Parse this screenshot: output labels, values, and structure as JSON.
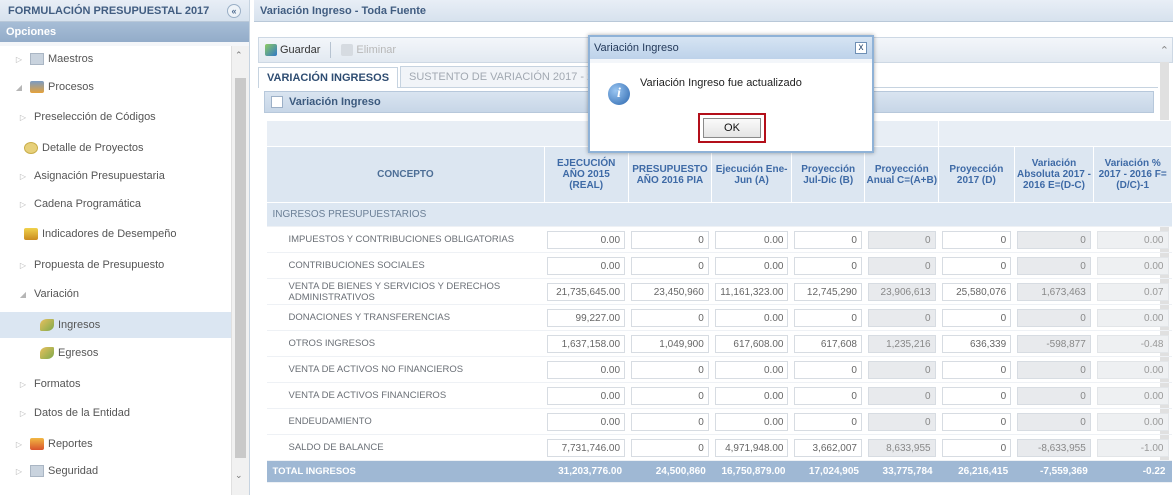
{
  "left_panel": {
    "title": "FORMULACIÓN PRESUPUESTAL 2017",
    "collapse_glyph": "«",
    "options_label": "Opciones",
    "tree": [
      {
        "label": "Maestros",
        "indent": 0,
        "arrow": "▷",
        "icon": "folder-icon"
      },
      {
        "label": "Procesos",
        "indent": 0,
        "arrow": "◢",
        "icon": "process-icon"
      },
      {
        "label": "Preselección de Códigos",
        "indent": 1,
        "arrow": "▷",
        "icon": ""
      },
      {
        "label": "Detalle de Proyectos",
        "indent": 2,
        "arrow": "",
        "icon": "detail-icon"
      },
      {
        "label": "Asignación Presupuestaria",
        "indent": 1,
        "arrow": "▷",
        "icon": ""
      },
      {
        "label": "Cadena Programática",
        "indent": 1,
        "arrow": "▷",
        "icon": ""
      },
      {
        "label": "Indicadores de Desempeño",
        "indent": 2,
        "arrow": "",
        "icon": "indicator-icon"
      },
      {
        "label": "Propuesta de Presupuesto",
        "indent": 1,
        "arrow": "▷",
        "icon": ""
      },
      {
        "label": "Variación",
        "indent": 1,
        "arrow": "◢",
        "icon": ""
      },
      {
        "label": "Ingresos",
        "indent": 3,
        "arrow": "",
        "icon": "leaf-icon",
        "selected": true
      },
      {
        "label": "Egresos",
        "indent": 3,
        "arrow": "",
        "icon": "leaf-icon"
      },
      {
        "label": "Formatos",
        "indent": 1,
        "arrow": "▷",
        "icon": ""
      },
      {
        "label": "Datos de la Entidad",
        "indent": 1,
        "arrow": "▷",
        "icon": ""
      },
      {
        "label": "Reportes",
        "indent": 0,
        "arrow": "▷",
        "icon": "report-icon"
      },
      {
        "label": "Seguridad",
        "indent": 0,
        "arrow": "▷",
        "icon": "security-icon"
      }
    ]
  },
  "main": {
    "title": "Variación Ingreso - Toda Fuente",
    "toolbar": {
      "save_label": "Guardar",
      "delete_label": "Eliminar"
    },
    "tabs": [
      {
        "label": "VARIACIÓN INGRESOS",
        "active": true
      },
      {
        "label": "SUSTENTO DE VARIACIÓN 2017 - 2016",
        "active": false
      }
    ],
    "section_title": "Variación Ingreso",
    "columns": [
      {
        "key": "concepto",
        "label": "CONCEPTO"
      },
      {
        "key": "ejec2015",
        "label": "EJECUCIÓN AÑO 2015 (REAL)"
      },
      {
        "key": "pia2016",
        "label": "PRESUPUESTO AÑO 2016 PIA"
      },
      {
        "key": "ejecA",
        "label": "Ejecución Ene-Jun (A)"
      },
      {
        "key": "proyB",
        "label": "Proyección Jul-Dic (B)"
      },
      {
        "key": "proyC",
        "label": "Proyección Anual C=(A+B)"
      },
      {
        "key": "proyD",
        "label": "Proyección 2017 (D)"
      },
      {
        "key": "varE",
        "label": "Variación Absoluta 2017 - 2016 E=(D-C)"
      },
      {
        "key": "varF",
        "label": "Variación % 2017 - 2016 F=(D/C)-1"
      }
    ],
    "group_label": "INGRESOS PRESUPUESTARIOS",
    "rows": [
      {
        "concepto": "IMPUESTOS Y CONTRIBUCIONES OBLIGATORIAS",
        "values": [
          "0.00",
          "0",
          "0.00",
          "0",
          "0",
          "0",
          "0",
          "0.00"
        ]
      },
      {
        "concepto": "CONTRIBUCIONES SOCIALES",
        "values": [
          "0.00",
          "0",
          "0.00",
          "0",
          "0",
          "0",
          "0",
          "0.00"
        ]
      },
      {
        "concepto": "VENTA DE BIENES Y SERVICIOS Y DERECHOS ADMINISTRATIVOS",
        "values": [
          "21,735,645.00",
          "23,450,960",
          "11,161,323.00",
          "12,745,290",
          "23,906,613",
          "25,580,076",
          "1,673,463",
          "0.07"
        ]
      },
      {
        "concepto": "DONACIONES Y TRANSFERENCIAS",
        "values": [
          "99,227.00",
          "0",
          "0.00",
          "0",
          "0",
          "0",
          "0",
          "0.00"
        ]
      },
      {
        "concepto": "OTROS INGRESOS",
        "values": [
          "1,637,158.00",
          "1,049,900",
          "617,608.00",
          "617,608",
          "1,235,216",
          "636,339",
          "-598,877",
          "-0.48"
        ]
      },
      {
        "concepto": "VENTA DE ACTIVOS NO FINANCIEROS",
        "values": [
          "0.00",
          "0",
          "0.00",
          "0",
          "0",
          "0",
          "0",
          "0.00"
        ]
      },
      {
        "concepto": "VENTA DE ACTIVOS FINANCIEROS",
        "values": [
          "0.00",
          "0",
          "0.00",
          "0",
          "0",
          "0",
          "0",
          "0.00"
        ]
      },
      {
        "concepto": "ENDEUDAMIENTO",
        "values": [
          "0.00",
          "0",
          "0.00",
          "0",
          "0",
          "0",
          "0",
          "0.00"
        ]
      },
      {
        "concepto": "SALDO DE BALANCE",
        "values": [
          "7,731,746.00",
          "0",
          "4,971,948.00",
          "3,662,007",
          "8,633,955",
          "0",
          "-8,633,955",
          "-1.00"
        ]
      }
    ],
    "total": {
      "label": "TOTAL INGRESOS",
      "values": [
        "31,203,776.00",
        "24,500,860",
        "16,750,879.00",
        "17,024,905",
        "33,775,784",
        "26,216,415",
        "-7,559,369",
        "-0.22"
      ]
    }
  },
  "dialog": {
    "title": "Variación Ingreso",
    "message": "Variación Ingreso fue actualizado",
    "ok_label": "OK",
    "close_glyph": "x",
    "info_glyph": "i"
  }
}
